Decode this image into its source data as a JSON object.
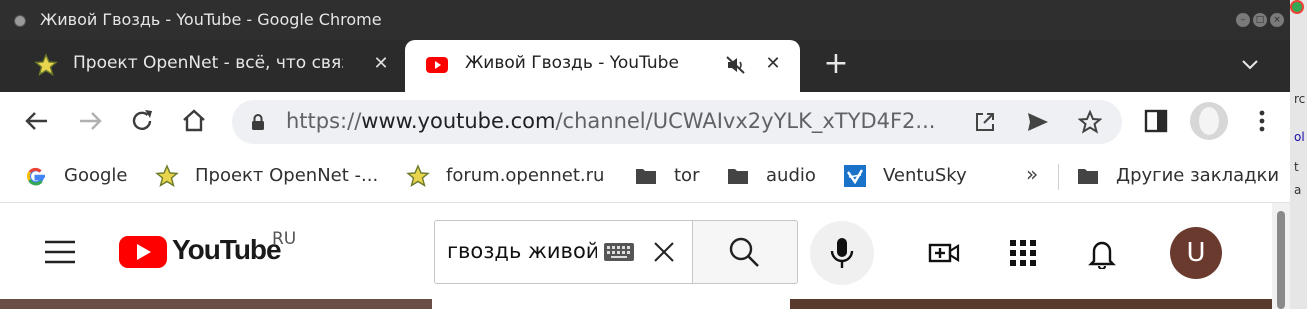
{
  "window": {
    "title": "Живой Гвоздь - YouTube - Google Chrome"
  },
  "tabs": [
    {
      "label": "Проект OpenNet - всё, что связ",
      "favicon": "star-favicon",
      "active": false
    },
    {
      "label": "Живой Гвоздь - YouTube",
      "favicon": "youtube-favicon",
      "active": true,
      "muted": true
    }
  ],
  "toolbar": {
    "url_scheme": "https://",
    "url_host": "www.youtube.com",
    "url_path": "/channel/UCWAIvx2yYLK_xTYD4F2..."
  },
  "bookmarks": [
    {
      "label": "Google",
      "icon": "google-icon"
    },
    {
      "label": "Проект OpenNet -...",
      "icon": "star-icon"
    },
    {
      "label": "forum.opennet.ru",
      "icon": "star-icon"
    },
    {
      "label": "tor",
      "icon": "folder-icon"
    },
    {
      "label": "audio",
      "icon": "folder-icon"
    },
    {
      "label": "VentuSky",
      "icon": "ventusky-icon"
    }
  ],
  "bookmarks_more": "»",
  "other_bookmarks": "Другие закладки",
  "youtube": {
    "logo_text": "YouTube",
    "region": "RU",
    "search_value": "гвоздь живой",
    "avatar_letter": "U",
    "colors": {
      "brand_red": "#ff0000",
      "avatar_bg": "#6b3a2f"
    }
  },
  "desktop_edge": {
    "fragments": [
      "rc",
      "ol",
      "t",
      "a"
    ]
  }
}
